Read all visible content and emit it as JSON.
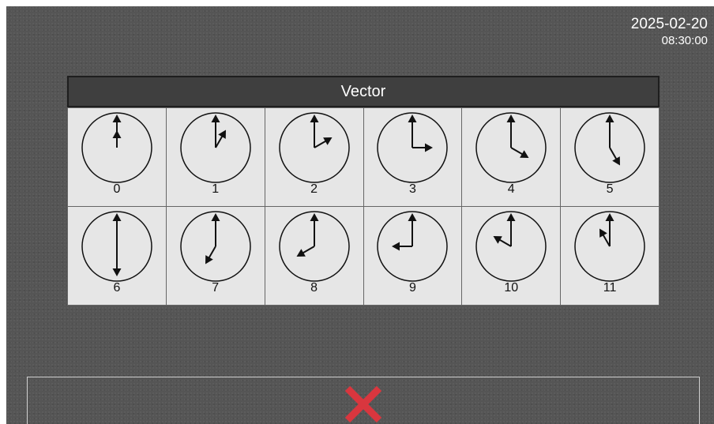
{
  "status": {
    "date": "2025-02-20",
    "time": "08:30:00"
  },
  "panel": {
    "title": "Vector",
    "items": [
      {
        "label": "0",
        "hour": 0
      },
      {
        "label": "1",
        "hour": 1
      },
      {
        "label": "2",
        "hour": 2
      },
      {
        "label": "3",
        "hour": 3
      },
      {
        "label": "4",
        "hour": 4
      },
      {
        "label": "5",
        "hour": 5
      },
      {
        "label": "6",
        "hour": 6
      },
      {
        "label": "7",
        "hour": 7
      },
      {
        "label": "8",
        "hour": 8
      },
      {
        "label": "9",
        "hour": 9
      },
      {
        "label": "10",
        "hour": 10
      },
      {
        "label": "11",
        "hour": 11
      }
    ]
  },
  "icons": {
    "cancel": "close-icon",
    "cancel_color": "#d9363e"
  }
}
